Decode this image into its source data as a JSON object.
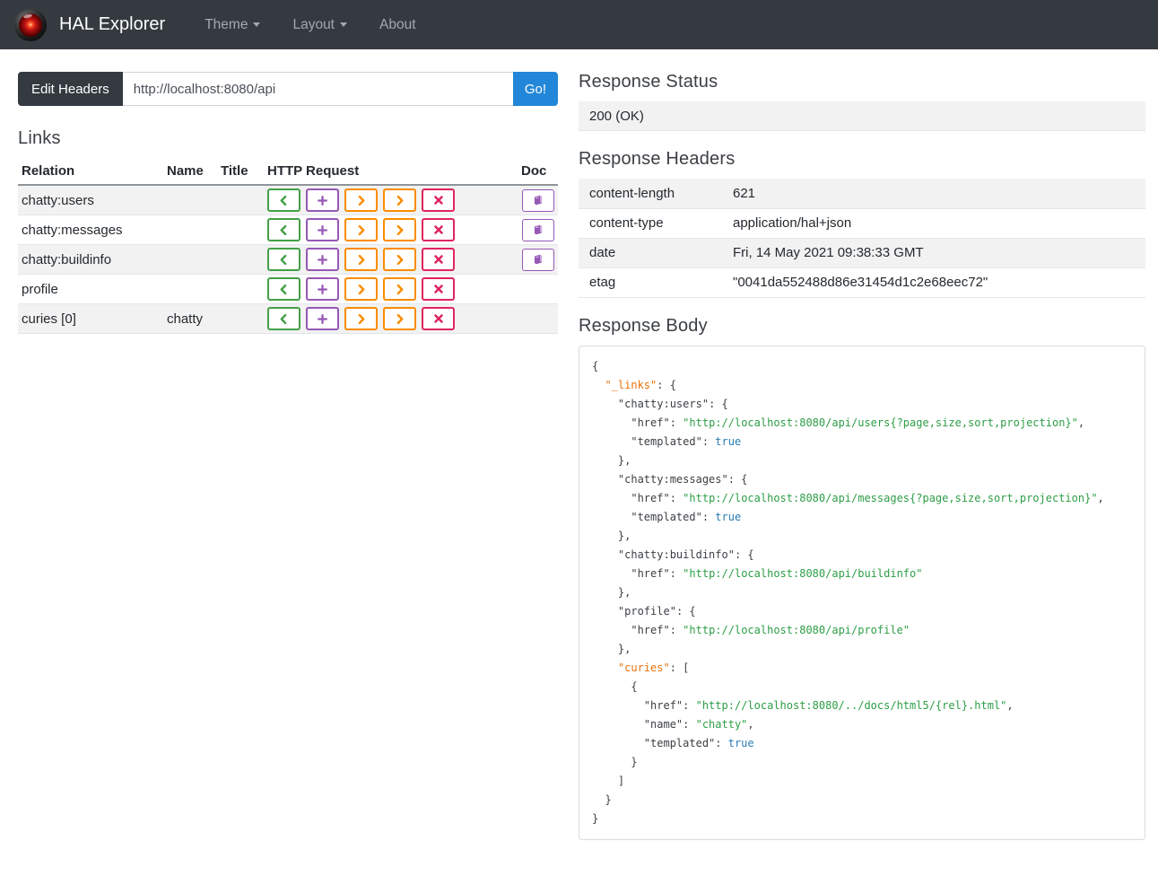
{
  "navbar": {
    "brand": "HAL Explorer",
    "items": [
      {
        "label": "Theme",
        "caret": true
      },
      {
        "label": "Layout",
        "caret": true
      },
      {
        "label": "About",
        "caret": false
      }
    ]
  },
  "request_bar": {
    "edit_headers_label": "Edit Headers",
    "url_value": "http://localhost:8080/api",
    "go_label": "Go!"
  },
  "links_section": {
    "title": "Links",
    "columns": [
      "Relation",
      "Name",
      "Title",
      "HTTP Request",
      "Doc"
    ],
    "http_buttons": [
      {
        "name": "get",
        "icon": "chevron-left-icon",
        "color": "#43a047"
      },
      {
        "name": "post",
        "icon": "plus-icon",
        "color": "#9658b5"
      },
      {
        "name": "put",
        "icon": "chevron-right-icon",
        "color": "#fb8c00"
      },
      {
        "name": "patch",
        "icon": "chevron-right-icon",
        "color": "#fb8c00"
      },
      {
        "name": "delete",
        "icon": "x-icon",
        "color": "#e0245e"
      }
    ],
    "doc_button": {
      "name": "doc",
      "icon": "book-icon",
      "color": "#9658b5"
    },
    "rows": [
      {
        "relation": "chatty:users",
        "name": "",
        "title": "",
        "doc": true
      },
      {
        "relation": "chatty:messages",
        "name": "",
        "title": "",
        "doc": true
      },
      {
        "relation": "chatty:buildinfo",
        "name": "",
        "title": "",
        "doc": true
      },
      {
        "relation": "profile",
        "name": "",
        "title": "",
        "doc": false
      },
      {
        "relation": "curies [0]",
        "name": "chatty",
        "title": "",
        "doc": false
      }
    ]
  },
  "response_status": {
    "title": "Response Status",
    "value": "200 (OK)"
  },
  "response_headers": {
    "title": "Response Headers",
    "rows": [
      {
        "name": "content-length",
        "value": "621"
      },
      {
        "name": "content-type",
        "value": "application/hal+json"
      },
      {
        "name": "date",
        "value": "Fri, 14 May 2021 09:38:33 GMT"
      },
      {
        "name": "etag",
        "value": "\"0041da552488d86e31454d1c2e68eec72\""
      }
    ]
  },
  "response_body": {
    "title": "Response Body",
    "lines": [
      [
        [
          "pn",
          "{"
        ]
      ],
      [
        [
          "pn",
          "  "
        ],
        [
          "hal",
          "\"_links\""
        ],
        [
          "pn",
          ": {"
        ]
      ],
      [
        [
          "pn",
          "    "
        ],
        [
          "key",
          "\"chatty:users\""
        ],
        [
          "pn",
          ": {"
        ]
      ],
      [
        [
          "pn",
          "      "
        ],
        [
          "key",
          "\"href\""
        ],
        [
          "pn",
          ": "
        ],
        [
          "str",
          "\"http://localhost:8080/api/users{?page,size,sort,projection}\""
        ],
        [
          "pn",
          ","
        ]
      ],
      [
        [
          "pn",
          "      "
        ],
        [
          "key",
          "\"templated\""
        ],
        [
          "pn",
          ": "
        ],
        [
          "bool",
          "true"
        ]
      ],
      [
        [
          "pn",
          "    },"
        ]
      ],
      [
        [
          "pn",
          "    "
        ],
        [
          "key",
          "\"chatty:messages\""
        ],
        [
          "pn",
          ": {"
        ]
      ],
      [
        [
          "pn",
          "      "
        ],
        [
          "key",
          "\"href\""
        ],
        [
          "pn",
          ": "
        ],
        [
          "str",
          "\"http://localhost:8080/api/messages{?page,size,sort,projection}\""
        ],
        [
          "pn",
          ","
        ]
      ],
      [
        [
          "pn",
          "      "
        ],
        [
          "key",
          "\"templated\""
        ],
        [
          "pn",
          ": "
        ],
        [
          "bool",
          "true"
        ]
      ],
      [
        [
          "pn",
          "    },"
        ]
      ],
      [
        [
          "pn",
          "    "
        ],
        [
          "key",
          "\"chatty:buildinfo\""
        ],
        [
          "pn",
          ": {"
        ]
      ],
      [
        [
          "pn",
          "      "
        ],
        [
          "key",
          "\"href\""
        ],
        [
          "pn",
          ": "
        ],
        [
          "str",
          "\"http://localhost:8080/api/buildinfo\""
        ]
      ],
      [
        [
          "pn",
          "    },"
        ]
      ],
      [
        [
          "pn",
          "    "
        ],
        [
          "key",
          "\"profile\""
        ],
        [
          "pn",
          ": {"
        ]
      ],
      [
        [
          "pn",
          "      "
        ],
        [
          "key",
          "\"href\""
        ],
        [
          "pn",
          ": "
        ],
        [
          "str",
          "\"http://localhost:8080/api/profile\""
        ]
      ],
      [
        [
          "pn",
          "    },"
        ]
      ],
      [
        [
          "pn",
          "    "
        ],
        [
          "hal",
          "\"curies\""
        ],
        [
          "pn",
          ": ["
        ]
      ],
      [
        [
          "pn",
          "      {"
        ]
      ],
      [
        [
          "pn",
          "        "
        ],
        [
          "key",
          "\"href\""
        ],
        [
          "pn",
          ": "
        ],
        [
          "str",
          "\"http://localhost:8080/../docs/html5/{rel}.html\""
        ],
        [
          "pn",
          ","
        ]
      ],
      [
        [
          "pn",
          "        "
        ],
        [
          "key",
          "\"name\""
        ],
        [
          "pn",
          ": "
        ],
        [
          "str",
          "\"chatty\""
        ],
        [
          "pn",
          ","
        ]
      ],
      [
        [
          "pn",
          "        "
        ],
        [
          "key",
          "\"templated\""
        ],
        [
          "pn",
          ": "
        ],
        [
          "bool",
          "true"
        ]
      ],
      [
        [
          "pn",
          "      }"
        ]
      ],
      [
        [
          "pn",
          "    ]"
        ]
      ],
      [
        [
          "pn",
          "  }"
        ]
      ],
      [
        [
          "pn",
          "}"
        ]
      ]
    ]
  },
  "colors": {
    "navbar_bg": "#343a40",
    "go_button": "#2287d8",
    "get_green": "#43a047",
    "post_purple": "#9658b5",
    "put_patch_orange": "#fb8c00",
    "delete_crimson": "#e0245e",
    "doc_purple": "#9658b5",
    "stripe_gray": "#f2f2f2",
    "json_hal_key": "#e8730c",
    "json_string": "#2d9e46",
    "json_bool": "#2a7db2"
  }
}
